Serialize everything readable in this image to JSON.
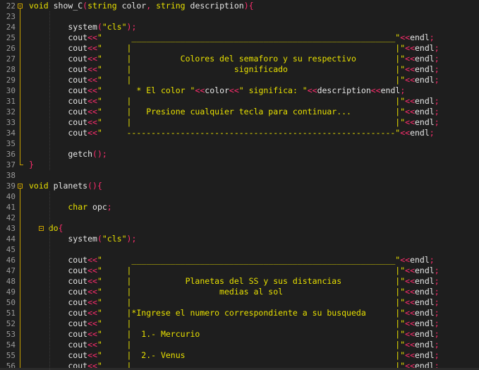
{
  "editor": {
    "lines": [
      {
        "n": "22",
        "tokens": [
          [
            "kw",
            "void"
          ],
          [
            "id",
            " show_C"
          ],
          [
            "paren",
            "("
          ],
          [
            "type",
            "string"
          ],
          [
            "id",
            " color"
          ],
          [
            "op",
            ","
          ],
          [
            "type",
            " string"
          ],
          [
            "id",
            " description"
          ],
          [
            "paren",
            ")"
          ],
          [
            "paren",
            "{"
          ]
        ]
      },
      {
        "n": "23",
        "tokens": []
      },
      {
        "n": "24",
        "tokens": [
          [
            "id",
            "        system"
          ],
          [
            "paren",
            "("
          ],
          [
            "str",
            "\"cls\""
          ],
          [
            "paren",
            ")"
          ],
          [
            "op",
            ";"
          ]
        ]
      },
      {
        "n": "25",
        "tokens": [
          [
            "id",
            "        cout"
          ],
          [
            "op",
            "<<"
          ],
          [
            "str",
            "\"      ______________________________________________________\""
          ],
          [
            "op",
            "<<"
          ],
          [
            "id",
            "endl"
          ],
          [
            "op",
            ";"
          ]
        ]
      },
      {
        "n": "26",
        "tokens": [
          [
            "id",
            "        cout"
          ],
          [
            "op",
            "<<"
          ],
          [
            "str",
            "\"     |                                                      |\""
          ],
          [
            "op",
            "<<"
          ],
          [
            "id",
            "endl"
          ],
          [
            "op",
            ";"
          ]
        ]
      },
      {
        "n": "27",
        "tokens": [
          [
            "id",
            "        cout"
          ],
          [
            "op",
            "<<"
          ],
          [
            "str",
            "\"     |          Colores del semaforo y su respectivo        |\""
          ],
          [
            "op",
            "<<"
          ],
          [
            "id",
            "endl"
          ],
          [
            "op",
            ";"
          ]
        ]
      },
      {
        "n": "28",
        "tokens": [
          [
            "id",
            "        cout"
          ],
          [
            "op",
            "<<"
          ],
          [
            "str",
            "\"     |                     significado                      |\""
          ],
          [
            "op",
            "<<"
          ],
          [
            "id",
            "endl"
          ],
          [
            "op",
            ";"
          ]
        ]
      },
      {
        "n": "29",
        "tokens": [
          [
            "id",
            "        cout"
          ],
          [
            "op",
            "<<"
          ],
          [
            "str",
            "\"     |                                                      |\""
          ],
          [
            "op",
            "<<"
          ],
          [
            "id",
            "endl"
          ],
          [
            "op",
            ";"
          ]
        ]
      },
      {
        "n": "30",
        "tokens": [
          [
            "id",
            "        cout"
          ],
          [
            "op",
            "<<"
          ],
          [
            "str",
            "\"       * El color \""
          ],
          [
            "op",
            "<<"
          ],
          [
            "id",
            "color"
          ],
          [
            "op",
            "<<"
          ],
          [
            "str",
            "\" significa: \""
          ],
          [
            "op",
            "<<"
          ],
          [
            "id",
            "description"
          ],
          [
            "op",
            "<<"
          ],
          [
            "id",
            "endl"
          ],
          [
            "op",
            ";"
          ]
        ]
      },
      {
        "n": "31",
        "tokens": [
          [
            "id",
            "        cout"
          ],
          [
            "op",
            "<<"
          ],
          [
            "str",
            "\"     |                                                      |\""
          ],
          [
            "op",
            "<<"
          ],
          [
            "id",
            "endl"
          ],
          [
            "op",
            ";"
          ]
        ]
      },
      {
        "n": "32",
        "tokens": [
          [
            "id",
            "        cout"
          ],
          [
            "op",
            "<<"
          ],
          [
            "str",
            "\"     |   Presione cualquier tecla para continuar...         |\""
          ],
          [
            "op",
            "<<"
          ],
          [
            "id",
            "endl"
          ],
          [
            "op",
            ";"
          ]
        ]
      },
      {
        "n": "33",
        "tokens": [
          [
            "id",
            "        cout"
          ],
          [
            "op",
            "<<"
          ],
          [
            "str",
            "\"     |                                                      |\""
          ],
          [
            "op",
            "<<"
          ],
          [
            "id",
            "endl"
          ],
          [
            "op",
            ";"
          ]
        ]
      },
      {
        "n": "34",
        "tokens": [
          [
            "id",
            "        cout"
          ],
          [
            "op",
            "<<"
          ],
          [
            "str",
            "\"     -------------------------------------------------------\""
          ],
          [
            "op",
            "<<"
          ],
          [
            "id",
            "endl"
          ],
          [
            "op",
            ";"
          ]
        ]
      },
      {
        "n": "35",
        "tokens": []
      },
      {
        "n": "36",
        "tokens": [
          [
            "id",
            "        getch"
          ],
          [
            "paren",
            "()"
          ],
          [
            "op",
            ";"
          ]
        ]
      },
      {
        "n": "37",
        "tokens": [
          [
            "paren",
            "}"
          ]
        ]
      },
      {
        "n": "38",
        "tokens": []
      },
      {
        "n": "39",
        "tokens": [
          [
            "kw",
            "void"
          ],
          [
            "id",
            " planets"
          ],
          [
            "paren",
            "()"
          ],
          [
            "paren",
            "{"
          ]
        ]
      },
      {
        "n": "40",
        "tokens": []
      },
      {
        "n": "41",
        "tokens": [
          [
            "type",
            "        char"
          ],
          [
            "id",
            " opc"
          ],
          [
            "op",
            ";"
          ]
        ]
      },
      {
        "n": "42",
        "tokens": []
      },
      {
        "n": "43",
        "tokens": [
          [
            "kw",
            "    do"
          ],
          [
            "paren",
            "{"
          ]
        ]
      },
      {
        "n": "44",
        "tokens": [
          [
            "id",
            "        system"
          ],
          [
            "paren",
            "("
          ],
          [
            "str",
            "\"cls\""
          ],
          [
            "paren",
            ")"
          ],
          [
            "op",
            ";"
          ]
        ]
      },
      {
        "n": "45",
        "tokens": []
      },
      {
        "n": "46",
        "tokens": [
          [
            "id",
            "        cout"
          ],
          [
            "op",
            "<<"
          ],
          [
            "str",
            "\"      ______________________________________________________\""
          ],
          [
            "op",
            "<<"
          ],
          [
            "id",
            "endl"
          ],
          [
            "op",
            ";"
          ]
        ]
      },
      {
        "n": "47",
        "tokens": [
          [
            "id",
            "        cout"
          ],
          [
            "op",
            "<<"
          ],
          [
            "str",
            "\"     |                                                      |\""
          ],
          [
            "op",
            "<<"
          ],
          [
            "id",
            "endl"
          ],
          [
            "op",
            ";"
          ]
        ]
      },
      {
        "n": "48",
        "tokens": [
          [
            "id",
            "        cout"
          ],
          [
            "op",
            "<<"
          ],
          [
            "str",
            "\"     |           Planetas del SS y sus distancias           |\""
          ],
          [
            "op",
            "<<"
          ],
          [
            "id",
            "endl"
          ],
          [
            "op",
            ";"
          ]
        ]
      },
      {
        "n": "49",
        "tokens": [
          [
            "id",
            "        cout"
          ],
          [
            "op",
            "<<"
          ],
          [
            "str",
            "\"     |                  medias al sol                       |\""
          ],
          [
            "op",
            "<<"
          ],
          [
            "id",
            "endl"
          ],
          [
            "op",
            ";"
          ]
        ]
      },
      {
        "n": "50",
        "tokens": [
          [
            "id",
            "        cout"
          ],
          [
            "op",
            "<<"
          ],
          [
            "str",
            "\"     |                                                      |\""
          ],
          [
            "op",
            "<<"
          ],
          [
            "id",
            "endl"
          ],
          [
            "op",
            ";"
          ]
        ]
      },
      {
        "n": "51",
        "tokens": [
          [
            "id",
            "        cout"
          ],
          [
            "op",
            "<<"
          ],
          [
            "str",
            "\"     |*Ingrese el numero correspondiente a su busqueda      |\""
          ],
          [
            "op",
            "<<"
          ],
          [
            "id",
            "endl"
          ],
          [
            "op",
            ";"
          ]
        ]
      },
      {
        "n": "52",
        "tokens": [
          [
            "id",
            "        cout"
          ],
          [
            "op",
            "<<"
          ],
          [
            "str",
            "\"     |                                                      |\""
          ],
          [
            "op",
            "<<"
          ],
          [
            "id",
            "endl"
          ],
          [
            "op",
            ";"
          ]
        ]
      },
      {
        "n": "53",
        "tokens": [
          [
            "id",
            "        cout"
          ],
          [
            "op",
            "<<"
          ],
          [
            "str",
            "\"     |  1.- Mercurio                                        |\""
          ],
          [
            "op",
            "<<"
          ],
          [
            "id",
            "endl"
          ],
          [
            "op",
            ";"
          ]
        ]
      },
      {
        "n": "54",
        "tokens": [
          [
            "id",
            "        cout"
          ],
          [
            "op",
            "<<"
          ],
          [
            "str",
            "\"     |                                                      |\""
          ],
          [
            "op",
            "<<"
          ],
          [
            "id",
            "endl"
          ],
          [
            "op",
            ";"
          ]
        ]
      },
      {
        "n": "55",
        "tokens": [
          [
            "id",
            "        cout"
          ],
          [
            "op",
            "<<"
          ],
          [
            "str",
            "\"     |  2.- Venus                                           |\""
          ],
          [
            "op",
            "<<"
          ],
          [
            "id",
            "endl"
          ],
          [
            "op",
            ";"
          ]
        ]
      },
      {
        "n": "56",
        "tokens": [
          [
            "id",
            "        cout"
          ],
          [
            "op",
            "<<"
          ],
          [
            "str",
            "\"     |                                                      |\""
          ],
          [
            "op",
            "<<"
          ],
          [
            "id",
            "endl"
          ],
          [
            "op",
            ";"
          ]
        ]
      }
    ],
    "colors": {
      "background": "#1e1e1e",
      "line_number": "#9a9a9a",
      "keyword": "#e8e000",
      "operator": "#ff2d6e",
      "identifier": "#e6e6e6",
      "fold_marker": "#c8a000"
    }
  }
}
